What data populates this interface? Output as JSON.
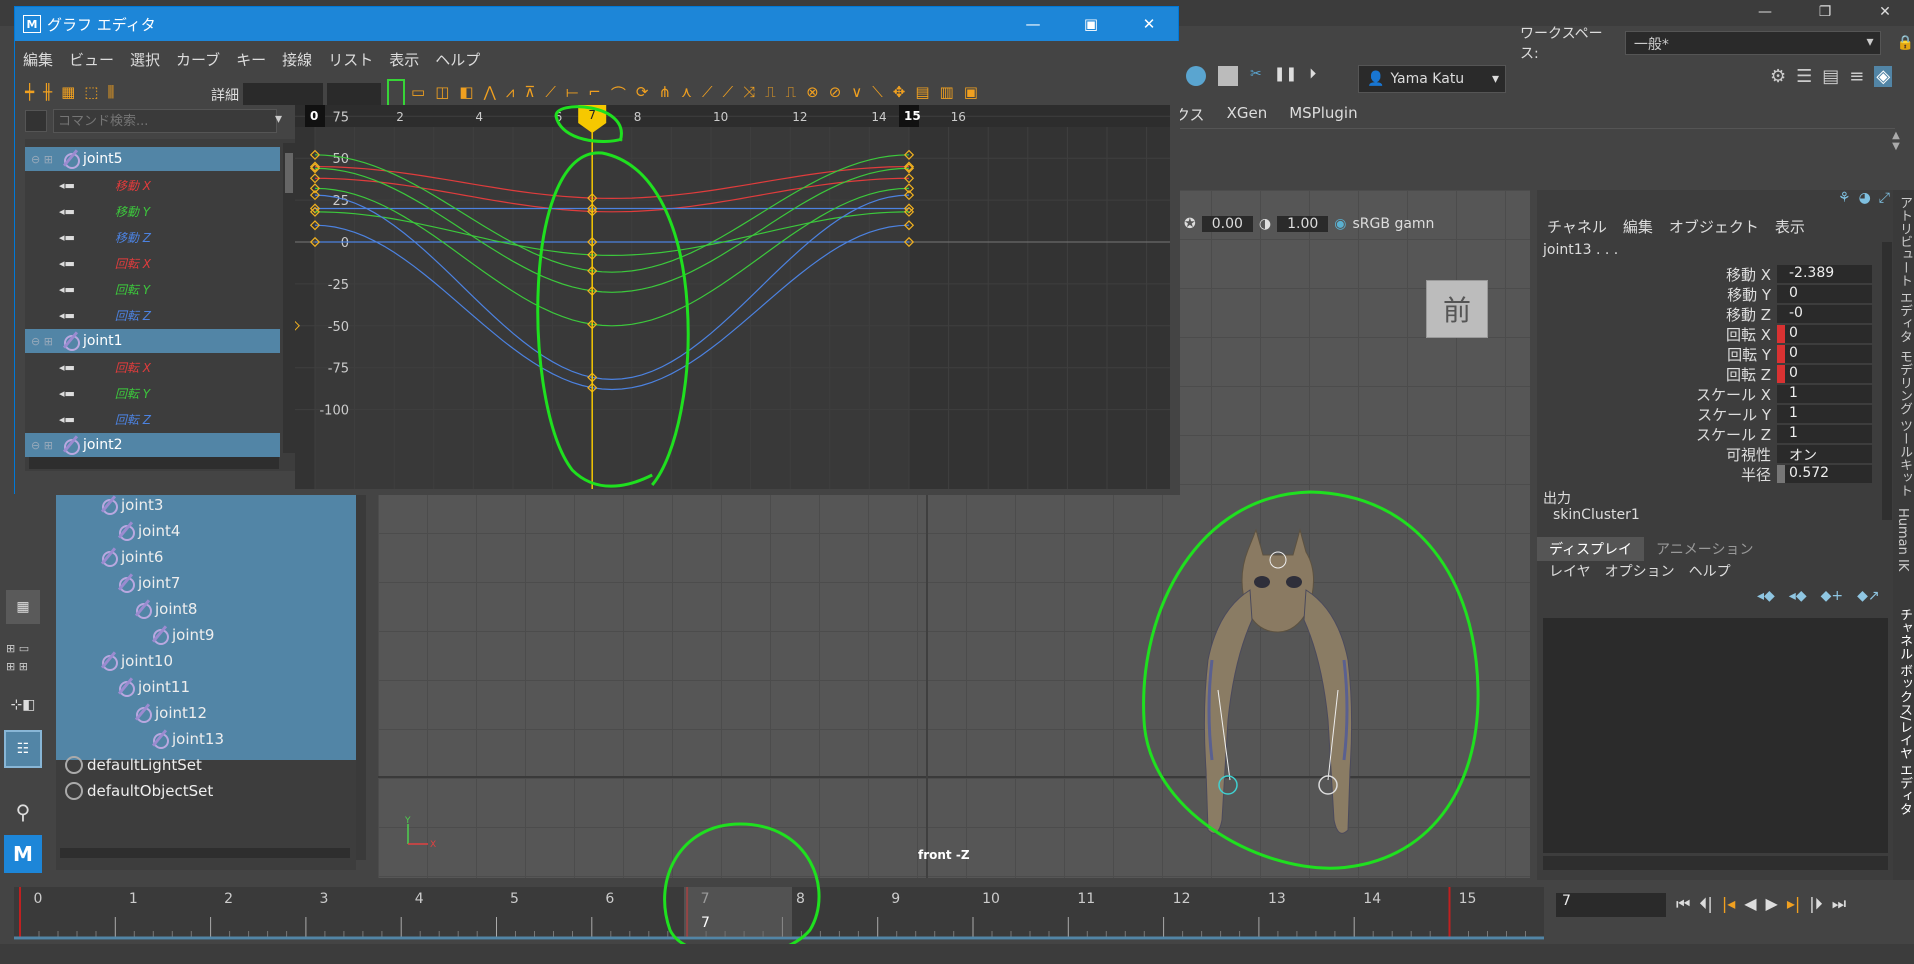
{
  "app": {
    "logo": "M"
  },
  "workspace": {
    "label": "ワークスペース:",
    "value": "一般*"
  },
  "user": {
    "name": "Yama Katu"
  },
  "shelf_tabs": [
    "ックス",
    "XGen",
    "MSPlugin"
  ],
  "graph_editor": {
    "title": "グラフ エディタ",
    "menu": [
      "編集",
      "ビュー",
      "選択",
      "カーブ",
      "キー",
      "接線",
      "リスト",
      "表示",
      "ヘルプ"
    ],
    "detail_label": "詳細",
    "search_placeholder": "コマンド検索...",
    "list": [
      {
        "label": "joint5",
        "type": "joint",
        "selected": true
      },
      {
        "label": "移動 X",
        "type": "channel",
        "color": "#e03c3c"
      },
      {
        "label": "移動 Y",
        "type": "channel",
        "color": "#3cc83c"
      },
      {
        "label": "移動 Z",
        "type": "channel",
        "color": "#4c82e0"
      },
      {
        "label": "回転 X",
        "type": "channel",
        "color": "#e03c3c"
      },
      {
        "label": "回転 Y",
        "type": "channel",
        "color": "#3cc83c"
      },
      {
        "label": "回転 Z",
        "type": "channel",
        "color": "#4c82e0"
      },
      {
        "label": "joint1",
        "type": "joint",
        "selected": true
      },
      {
        "label": "回転 X",
        "type": "channel",
        "color": "#e03c3c"
      },
      {
        "label": "回転 Y",
        "type": "channel",
        "color": "#3cc83c"
      },
      {
        "label": "回転 Z",
        "type": "channel",
        "color": "#4c82e0"
      },
      {
        "label": "joint2",
        "type": "joint",
        "selected": true
      }
    ],
    "ruler": [
      "0",
      "2",
      "4",
      "6",
      "8",
      "10",
      "12",
      "14",
      "16"
    ],
    "start_marker": "0",
    "end_marker": "15",
    "current_frame": "7",
    "value_ticks": [
      "75",
      "50",
      "25",
      "0",
      "-25",
      "-50",
      "-75",
      "-100"
    ]
  },
  "outliner": {
    "items": [
      {
        "label": "joint3",
        "depth": 3,
        "selected": true,
        "kind": "joint"
      },
      {
        "label": "joint4",
        "depth": 4,
        "selected": true,
        "kind": "joint"
      },
      {
        "label": "joint6",
        "depth": 3,
        "selected": true,
        "kind": "joint"
      },
      {
        "label": "joint7",
        "depth": 4,
        "selected": true,
        "kind": "joint"
      },
      {
        "label": "joint8",
        "depth": 5,
        "selected": true,
        "kind": "joint"
      },
      {
        "label": "joint9",
        "depth": 6,
        "selected": true,
        "kind": "joint"
      },
      {
        "label": "joint10",
        "depth": 3,
        "selected": true,
        "kind": "joint"
      },
      {
        "label": "joint11",
        "depth": 4,
        "selected": true,
        "kind": "joint"
      },
      {
        "label": "joint12",
        "depth": 5,
        "selected": true,
        "kind": "joint"
      },
      {
        "label": "joint13",
        "depth": 6,
        "selected": true,
        "kind": "joint"
      },
      {
        "label": "defaultLightSet",
        "depth": 1,
        "selected": false,
        "kind": "set"
      },
      {
        "label": "defaultObjectSet",
        "depth": 1,
        "selected": false,
        "kind": "set"
      }
    ]
  },
  "viewport": {
    "exposure": "0.00",
    "gamma": "1.00",
    "color_space": "sRGB gamn",
    "view_cube": "前",
    "camera_label": "front -Z"
  },
  "channel_box": {
    "menu": [
      "チャネル",
      "編集",
      "オブジェクト",
      "表示"
    ],
    "object": "joint13 . . .",
    "attrs": [
      {
        "label": "移動 X",
        "value": "-2.389",
        "keyed": false
      },
      {
        "label": "移動 Y",
        "value": "0",
        "keyed": false
      },
      {
        "label": "移動 Z",
        "value": "-0",
        "keyed": false
      },
      {
        "label": "回転 X",
        "value": "0",
        "keyed": true
      },
      {
        "label": "回転 Y",
        "value": "0",
        "keyed": true
      },
      {
        "label": "回転 Z",
        "value": "0",
        "keyed": true
      },
      {
        "label": "スケール X",
        "value": "1",
        "keyed": false
      },
      {
        "label": "スケール Y",
        "value": "1",
        "keyed": false
      },
      {
        "label": "スケール Z",
        "value": "1",
        "keyed": false
      },
      {
        "label": "可視性",
        "value": "オン",
        "keyed": false
      },
      {
        "label": "半径",
        "value": "0.572",
        "keyed": false
      }
    ],
    "outputs_label": "出力",
    "output_node": "skinCluster1",
    "layer_tabs": [
      "ディスプレイ",
      "アニメーション"
    ],
    "layer_menu": [
      "レイヤ",
      "オプション",
      "ヘルプ"
    ]
  },
  "side_tabs": [
    "アトリビュート エディタ",
    "モデリング ツールキット",
    "Human IK",
    "チャネル ボックス/レイヤ エディタ"
  ],
  "timeline": {
    "ticks": [
      "0",
      "1",
      "2",
      "3",
      "4",
      "5",
      "6",
      "7",
      "8",
      "9",
      "10",
      "11",
      "12",
      "13",
      "14",
      "15"
    ],
    "current": "7",
    "frame_field": "7"
  },
  "colors": {
    "accent": "#1d86d8",
    "selection": "#5285a6",
    "annotation": "#1fe01f",
    "current_time": "#f6c800"
  }
}
